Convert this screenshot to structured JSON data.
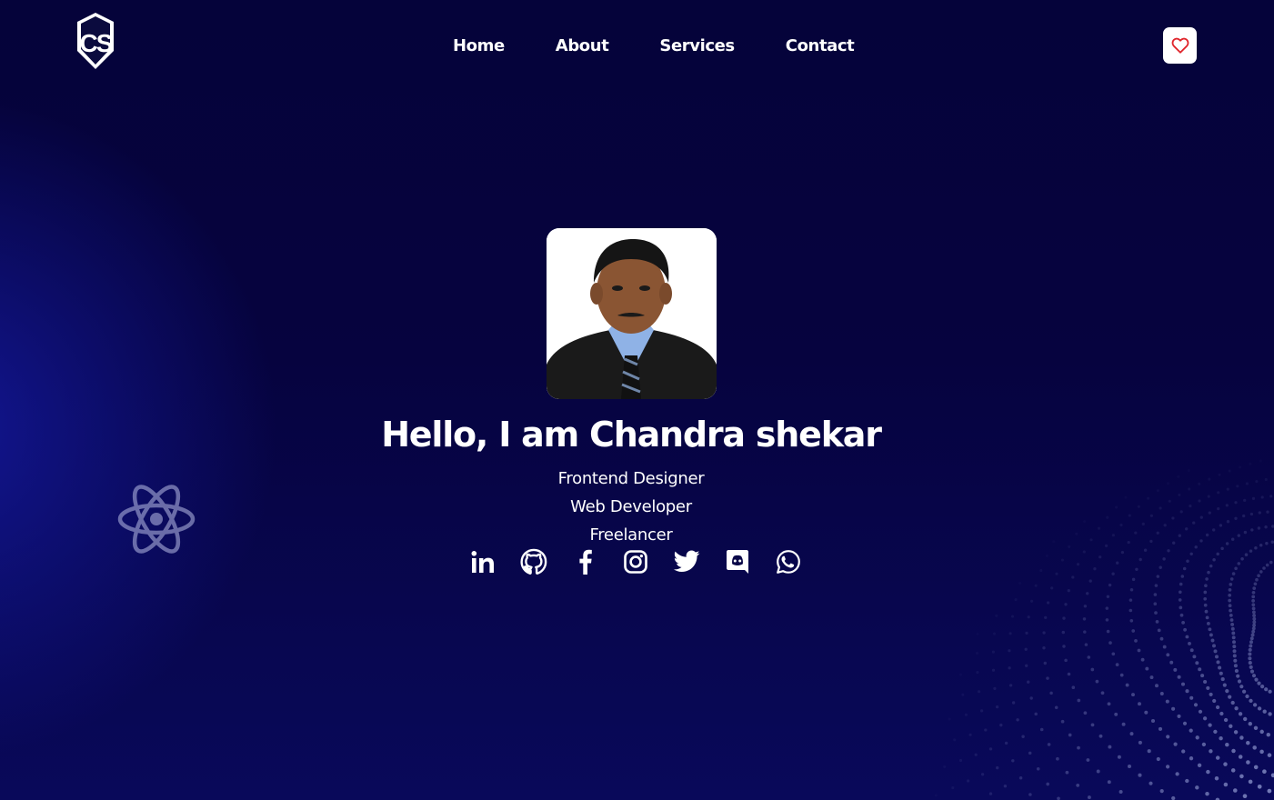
{
  "brand": {
    "logo_text": "CS"
  },
  "nav": {
    "items": [
      {
        "label": "Home"
      },
      {
        "label": "About"
      },
      {
        "label": "Services"
      },
      {
        "label": "Contact"
      }
    ]
  },
  "header": {
    "favorite_icon": "heart-icon"
  },
  "hero": {
    "title": "Hello, I am Chandra shekar",
    "roles": [
      "Frontend Designer",
      "Web Developer",
      "Freelancer"
    ]
  },
  "socials": [
    {
      "icon": "linkedin-icon"
    },
    {
      "icon": "github-icon"
    },
    {
      "icon": "facebook-icon"
    },
    {
      "icon": "instagram-icon"
    },
    {
      "icon": "twitter-icon"
    },
    {
      "icon": "discord-icon"
    },
    {
      "icon": "whatsapp-icon"
    }
  ],
  "colors": {
    "background_top": "#05033a",
    "background_glow": "#1419a0",
    "text": "#ffffff",
    "heart": "#e0252b"
  }
}
